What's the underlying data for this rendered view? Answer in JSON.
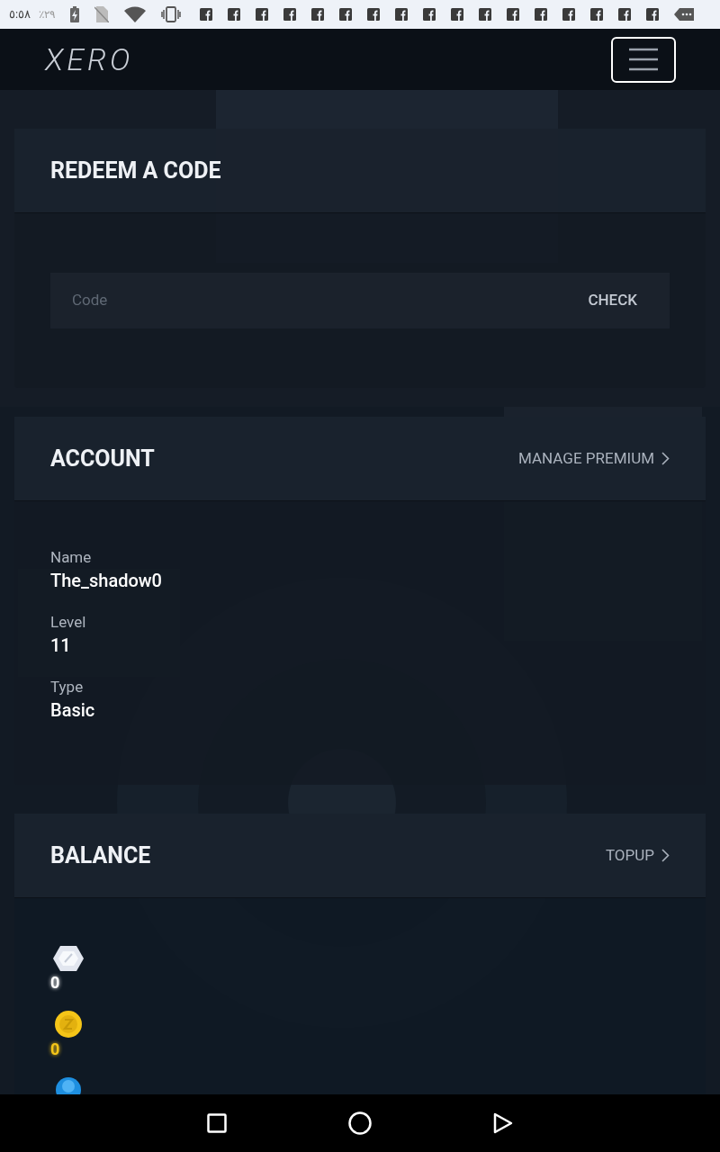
{
  "status_bar": {
    "time": "٥:٥٨",
    "battery": "٪٢٩",
    "notifications": [
      {
        "kind": "facebook"
      },
      {
        "kind": "facebook"
      },
      {
        "kind": "facebook"
      },
      {
        "kind": "facebook"
      },
      {
        "kind": "facebook"
      },
      {
        "kind": "facebook"
      },
      {
        "kind": "facebook"
      },
      {
        "kind": "facebook"
      },
      {
        "kind": "facebook"
      },
      {
        "kind": "facebook"
      },
      {
        "kind": "facebook"
      },
      {
        "kind": "facebook"
      },
      {
        "kind": "facebook"
      },
      {
        "kind": "facebook"
      },
      {
        "kind": "facebook"
      },
      {
        "kind": "facebook"
      },
      {
        "kind": "facebook"
      },
      {
        "kind": "more"
      }
    ]
  },
  "header": {
    "logo": "XERO"
  },
  "redeem": {
    "title": "REDEEM A CODE",
    "placeholder": "Code",
    "button": "CHECK"
  },
  "account": {
    "title": "ACCOUNT",
    "link": "MANAGE PREMIUM",
    "fields": [
      {
        "label": "Name",
        "value": "The_shadow0"
      },
      {
        "label": "Level",
        "value": "11"
      },
      {
        "label": "Type",
        "value": "Basic"
      }
    ]
  },
  "balance": {
    "title": "BALANCE",
    "link": "TOPUP",
    "items": [
      {
        "kind": "gem",
        "amount": "0",
        "color": "#ffffff"
      },
      {
        "kind": "coin",
        "amount": "0",
        "color": "#f5c518"
      },
      {
        "kind": "orb"
      }
    ]
  }
}
